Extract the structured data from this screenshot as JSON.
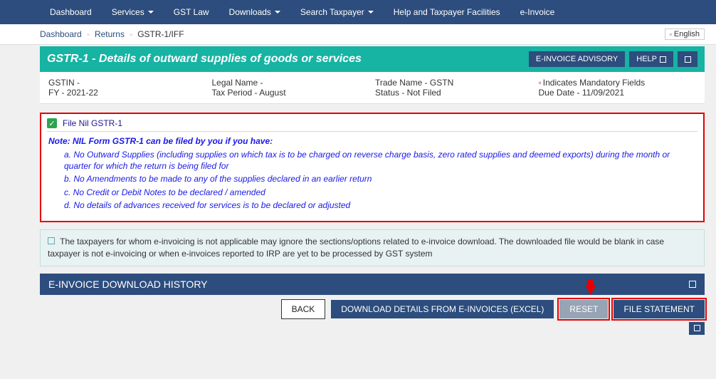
{
  "nav": {
    "items": [
      {
        "label": "Dashboard",
        "dropdown": false
      },
      {
        "label": "Services",
        "dropdown": true
      },
      {
        "label": "GST Law",
        "dropdown": false
      },
      {
        "label": "Downloads",
        "dropdown": true
      },
      {
        "label": "Search Taxpayer",
        "dropdown": true
      },
      {
        "label": "Help and Taxpayer Facilities",
        "dropdown": false
      },
      {
        "label": "e-Invoice",
        "dropdown": false
      }
    ]
  },
  "breadcrumb": {
    "items": [
      "Dashboard",
      "Returns",
      "GSTR-1/IFF"
    ],
    "language": "English"
  },
  "title": {
    "heading": "GSTR-1 - Details of outward supplies of goods or services",
    "advisory_btn": "E-INVOICE ADVISORY",
    "help_btn": "HELP"
  },
  "info": {
    "gstin_label": "GSTIN -",
    "fy": "FY - 2021-22",
    "legal_name": "Legal Name -",
    "tax_period": "Tax Period - August",
    "trade_name": "Trade Name - GSTN",
    "status": "Status - Not Filed",
    "mandatory": "Indicates Mandatory Fields",
    "due_date": "Due Date - 11/09/2021"
  },
  "nil": {
    "checkbox_label": "File Nil GSTR-1",
    "note_title": "Note: NIL Form GSTR-1 can be filed by you if you have:",
    "conditions": [
      "a. No Outward Supplies (including supplies on which tax is to be charged on reverse charge basis, zero rated supplies and deemed exports) during the month or quarter for which the return is being filed for",
      "b. No Amendments to be made to any of the supplies declared in an earlier return",
      "c. No Credit or Debit Notes to be declared / amended",
      "d. No details of advances received for services is to be declared or adjusted"
    ]
  },
  "alert": {
    "text": "The taxpayers for whom e-invoicing is not applicable may ignore the sections/options related to e-invoice download. The downloaded file would be blank in case taxpayer is not e-invoicing or when e-invoices reported to IRP are yet to be processed by GST system"
  },
  "history": {
    "title": "E-INVOICE DOWNLOAD HISTORY"
  },
  "footer": {
    "back": "BACK",
    "download": "DOWNLOAD DETAILS FROM E-INVOICES (EXCEL)",
    "reset": "RESET",
    "file": "FILE STATEMENT"
  }
}
